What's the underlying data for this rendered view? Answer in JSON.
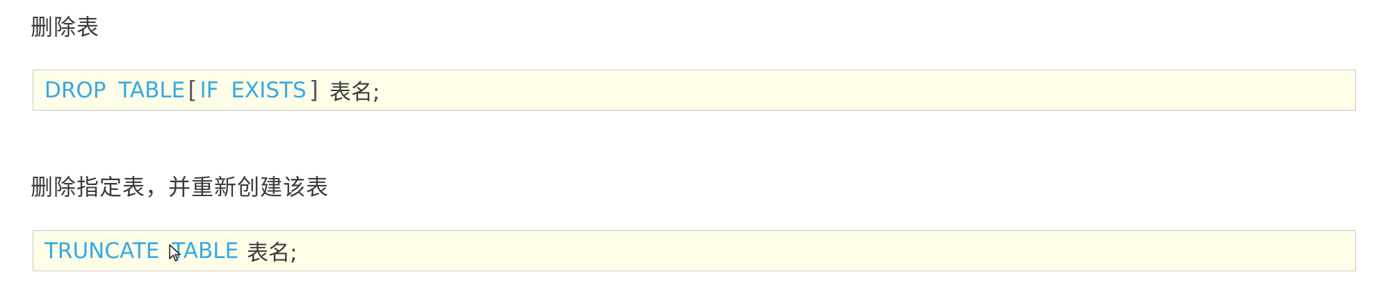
{
  "section1": {
    "heading": "删除表",
    "code": {
      "kw1": "DROP TABLE",
      "bracket_open": "[",
      "kw2": "IF EXISTS",
      "bracket_close": "]",
      "table": "表名;"
    }
  },
  "section2": {
    "heading": "删除指定表，并重新创建该表",
    "code": {
      "kw1": "TRUNCATE TABLE",
      "table": "表名;"
    }
  },
  "colors": {
    "keyword": "#35a9e6",
    "code_background": "#fefde8",
    "code_border": "#c8c8c8",
    "text": "#3b3b3b"
  },
  "icons": {
    "cursor": "mouse-pointer-icon"
  }
}
